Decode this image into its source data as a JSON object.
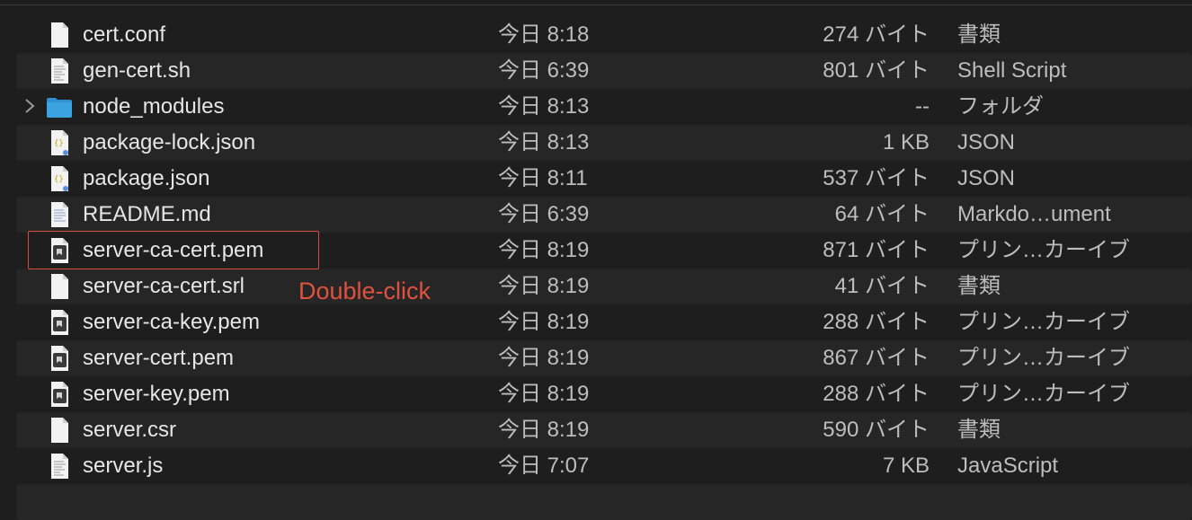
{
  "files": [
    {
      "name": "cert.conf",
      "date": "今日 8:18",
      "size": "274 バイト",
      "kind": "書類",
      "icon": "document-icon"
    },
    {
      "name": "gen-cert.sh",
      "date": "今日 6:39",
      "size": "801 バイト",
      "kind": "Shell Script",
      "icon": "script-icon"
    },
    {
      "name": "node_modules",
      "date": "今日 8:13",
      "size": "--",
      "kind": "フォルダ",
      "icon": "folder-icon"
    },
    {
      "name": "package-lock.json",
      "date": "今日 8:13",
      "size": "1 KB",
      "kind": "JSON",
      "icon": "json-icon"
    },
    {
      "name": "package.json",
      "date": "今日 8:11",
      "size": "537 バイト",
      "kind": "JSON",
      "icon": "json-icon"
    },
    {
      "name": "README.md",
      "date": "今日 6:39",
      "size": "64 バイト",
      "kind": "Markdo…ument",
      "icon": "markdown-icon"
    },
    {
      "name": "server-ca-cert.pem",
      "date": "今日 8:19",
      "size": "871 バイト",
      "kind": "プリン…カーイブ",
      "icon": "certificate-icon"
    },
    {
      "name": "server-ca-cert.srl",
      "date": "今日 8:19",
      "size": "41 バイト",
      "kind": "書類",
      "icon": "document-icon"
    },
    {
      "name": "server-ca-key.pem",
      "date": "今日 8:19",
      "size": "288 バイト",
      "kind": "プリン…カーイブ",
      "icon": "certificate-icon"
    },
    {
      "name": "server-cert.pem",
      "date": "今日 8:19",
      "size": "867 バイト",
      "kind": "プリン…カーイブ",
      "icon": "certificate-icon"
    },
    {
      "name": "server-key.pem",
      "date": "今日 8:19",
      "size": "288 バイト",
      "kind": "プリン…カーイブ",
      "icon": "certificate-icon"
    },
    {
      "name": "server.csr",
      "date": "今日 8:19",
      "size": "590 バイト",
      "kind": "書類",
      "icon": "document-icon"
    },
    {
      "name": "server.js",
      "date": "今日 7:07",
      "size": "7 KB",
      "kind": "JavaScript",
      "icon": "script-icon"
    }
  ],
  "annotation": {
    "label": "Double-click",
    "color": "#e0513e"
  },
  "colors": {
    "background": "#1e1e1e",
    "row_alt": "#262626",
    "folder": "#3aa3e0",
    "highlight_border": "#d94a3a"
  }
}
